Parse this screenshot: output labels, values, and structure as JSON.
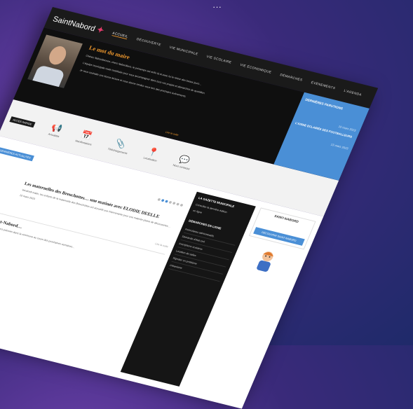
{
  "tagline": "...",
  "logo": {
    "name": "SaintNabord"
  },
  "nav": {
    "items": [
      "ACCUEIL",
      "DÉCOUVERTE",
      "VIE MUNICIPALE",
      "VIE SCOLAIRE",
      "VIE ÉCONOMIQUE",
      "DÉMARCHES",
      "ÉVÉNEMENTS",
      "L'AGENDA"
    ]
  },
  "hero": {
    "title": "Le mot du maire",
    "paragraphs": [
      "Chères Nabordiennes, chers Nabordiens, le printemps est enfin là et avec lui le retour des beaux jours...",
      "L'équipe municipale reste mobilisée pour vous accompagner dans tous vos projets et démarches du quotidien.",
      "Je vous souhaite une bonne lecture et vous donne rendez-vous lors des prochains événements."
    ],
    "more_link": "Lire la suite"
  },
  "side_panel": {
    "title": "DERNIÈRES PARUTIONS",
    "date1": "10 mars 2023",
    "article": "L'AISNE ECLAIRÉE DES FOOTBALLEURS",
    "date2": "13 mars 2023"
  },
  "quick_access": {
    "badge": "ACCÈS RAPIDE",
    "items": [
      {
        "label": "Actualités",
        "icon": "megaphone-icon",
        "glyph": "📢"
      },
      {
        "label": "Manifestations",
        "icon": "calendar-icon",
        "glyph": "📅"
      },
      {
        "label": "Téléchargements",
        "icon": "paperclip-icon",
        "glyph": "📎"
      },
      {
        "label": "Localisation",
        "icon": "map-pin-icon",
        "glyph": "📍"
      },
      {
        "label": "Nous contacter",
        "icon": "chat-bubble-icon",
        "glyph": "💬"
      }
    ]
  },
  "news": {
    "tag": "DERNIÈRES ACTUALITÉS",
    "article1": {
      "title": "Les maternelles des Breuchottes… une matinée avec ELODIE DEELLE",
      "text": "Vendredi matin, les enfants de la maternelle des Breuchottes ont accueilli une intervenante pour une matinée pleine de découvertes…",
      "date": "10 mars 2023",
      "more": "Lire la suite"
    },
    "article2": {
      "title": "Ça bouge à Saint-Nabord…",
      "text": "Retrouvez toutes les animations prévues dans la commune au cours des prochaines semaines…"
    }
  },
  "gazette": {
    "title": "LA GAZETTE MUNICIPALE",
    "lines": [
      "Consulter la dernière édition",
      "en ligne"
    ],
    "demarches_title": "DÉMARCHES EN LIGNE",
    "items": [
      "Formulaires administratifs",
      "Demande d'état civil",
      "Inscriptions scolaires",
      "Location de salles",
      "Signaler un problème",
      "Urbanisme"
    ]
  },
  "saint_nabord": {
    "title": "SAINT-NABORD",
    "button": "DÉCOUVRIR SAINT-NABORD"
  }
}
